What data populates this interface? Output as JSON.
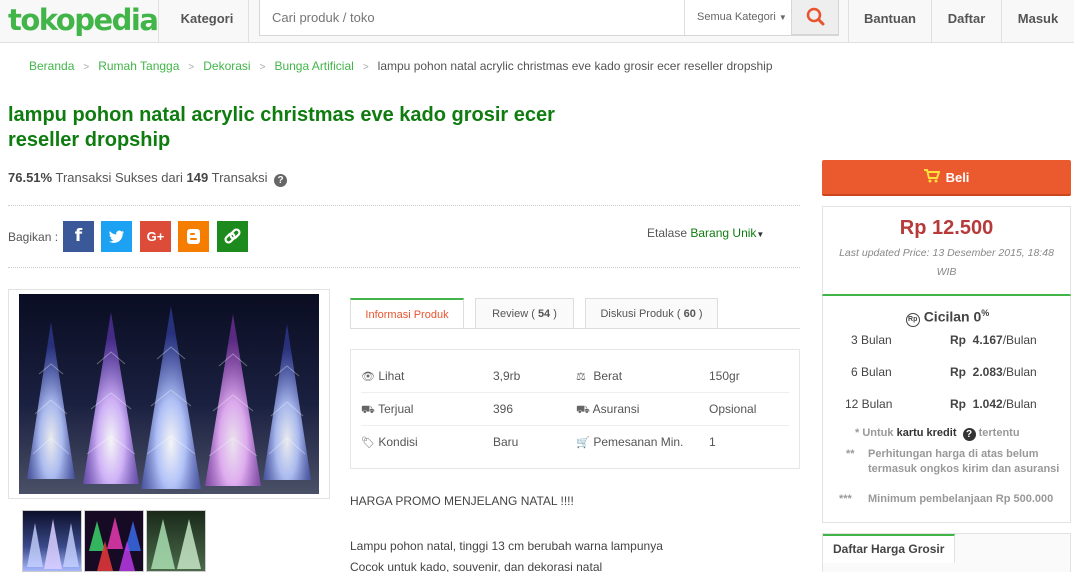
{
  "header": {
    "logo": "tokopedia",
    "kategori": "Kategori",
    "search_placeholder": "Cari produk / toko",
    "search_category": "Semua Kategori",
    "nav": [
      "Bantuan",
      "Daftar",
      "Masuk"
    ]
  },
  "breadcrumb": [
    "Beranda",
    "Rumah Tangga",
    "Dekorasi",
    "Bunga Artificial",
    "lampu pohon natal acrylic christmas eve kado grosir ecer reseller dropship"
  ],
  "product": {
    "title": "lampu pohon natal acrylic christmas eve kado grosir ecer reseller dropship",
    "success_rate": "76.51%",
    "success_text": "Transaksi Sukses dari",
    "transactions": "149",
    "transactions_label": "Transaksi",
    "share_label": "Bagikan :",
    "etalase_label": "Etalase",
    "etalase_value": "Barang Unik"
  },
  "tabs": {
    "info": "Informasi Produk",
    "review_label": "Review",
    "review_count": "54",
    "diskusi_label": "Diskusi Produk",
    "diskusi_count": "60"
  },
  "info": {
    "lihat_label": "Lihat",
    "lihat_value": "3,9rb",
    "berat_label": "Berat",
    "berat_value": "150gr",
    "terjual_label": "Terjual",
    "terjual_value": "396",
    "asuransi_label": "Asuransi",
    "asuransi_value": "Opsional",
    "kondisi_label": "Kondisi",
    "kondisi_value": "Baru",
    "pemesanan_label": "Pemesanan Min.",
    "pemesanan_value": "1"
  },
  "description": [
    "HARGA PROMO MENJELANG NATAL !!!!",
    "Lampu pohon natal, tinggi 13 cm berubah warna lampunya",
    "Cocok untuk kado, souvenir, dan dekorasi natal"
  ],
  "buy": {
    "label": "Beli",
    "price": "Rp 12.500",
    "updated": "Last updated Price: 13 Desember 2015, 18:48 WIB"
  },
  "cicilan": {
    "title": "Cicilan 0",
    "percent": "%",
    "rp_badge": "Rp",
    "rows": [
      {
        "bulan": "3 Bulan",
        "rp": "Rp",
        "amount": "4.167",
        "unit": "/Bulan"
      },
      {
        "bulan": "6 Bulan",
        "rp": "Rp",
        "amount": "2.083",
        "unit": "/Bulan"
      },
      {
        "bulan": "12 Bulan",
        "rp": "Rp",
        "amount": "1.042",
        "unit": "/Bulan"
      }
    ],
    "note1_star": "*",
    "note1_a": "Untuk",
    "note1_b": "kartu kredit",
    "note1_c": "tertentu",
    "note2_star": "**",
    "note2": "Perhitungan harga di atas belum termasuk ongkos kirim dan asuransi",
    "note3_star": "***",
    "note3": "Minimum pembelanjaan Rp 500.000"
  },
  "grosir": {
    "title": "Daftar Harga Grosir"
  },
  "colors": {
    "brand_green": "#42b549",
    "buy_orange": "#ea5a2e",
    "price_red": "#b73a3a"
  }
}
